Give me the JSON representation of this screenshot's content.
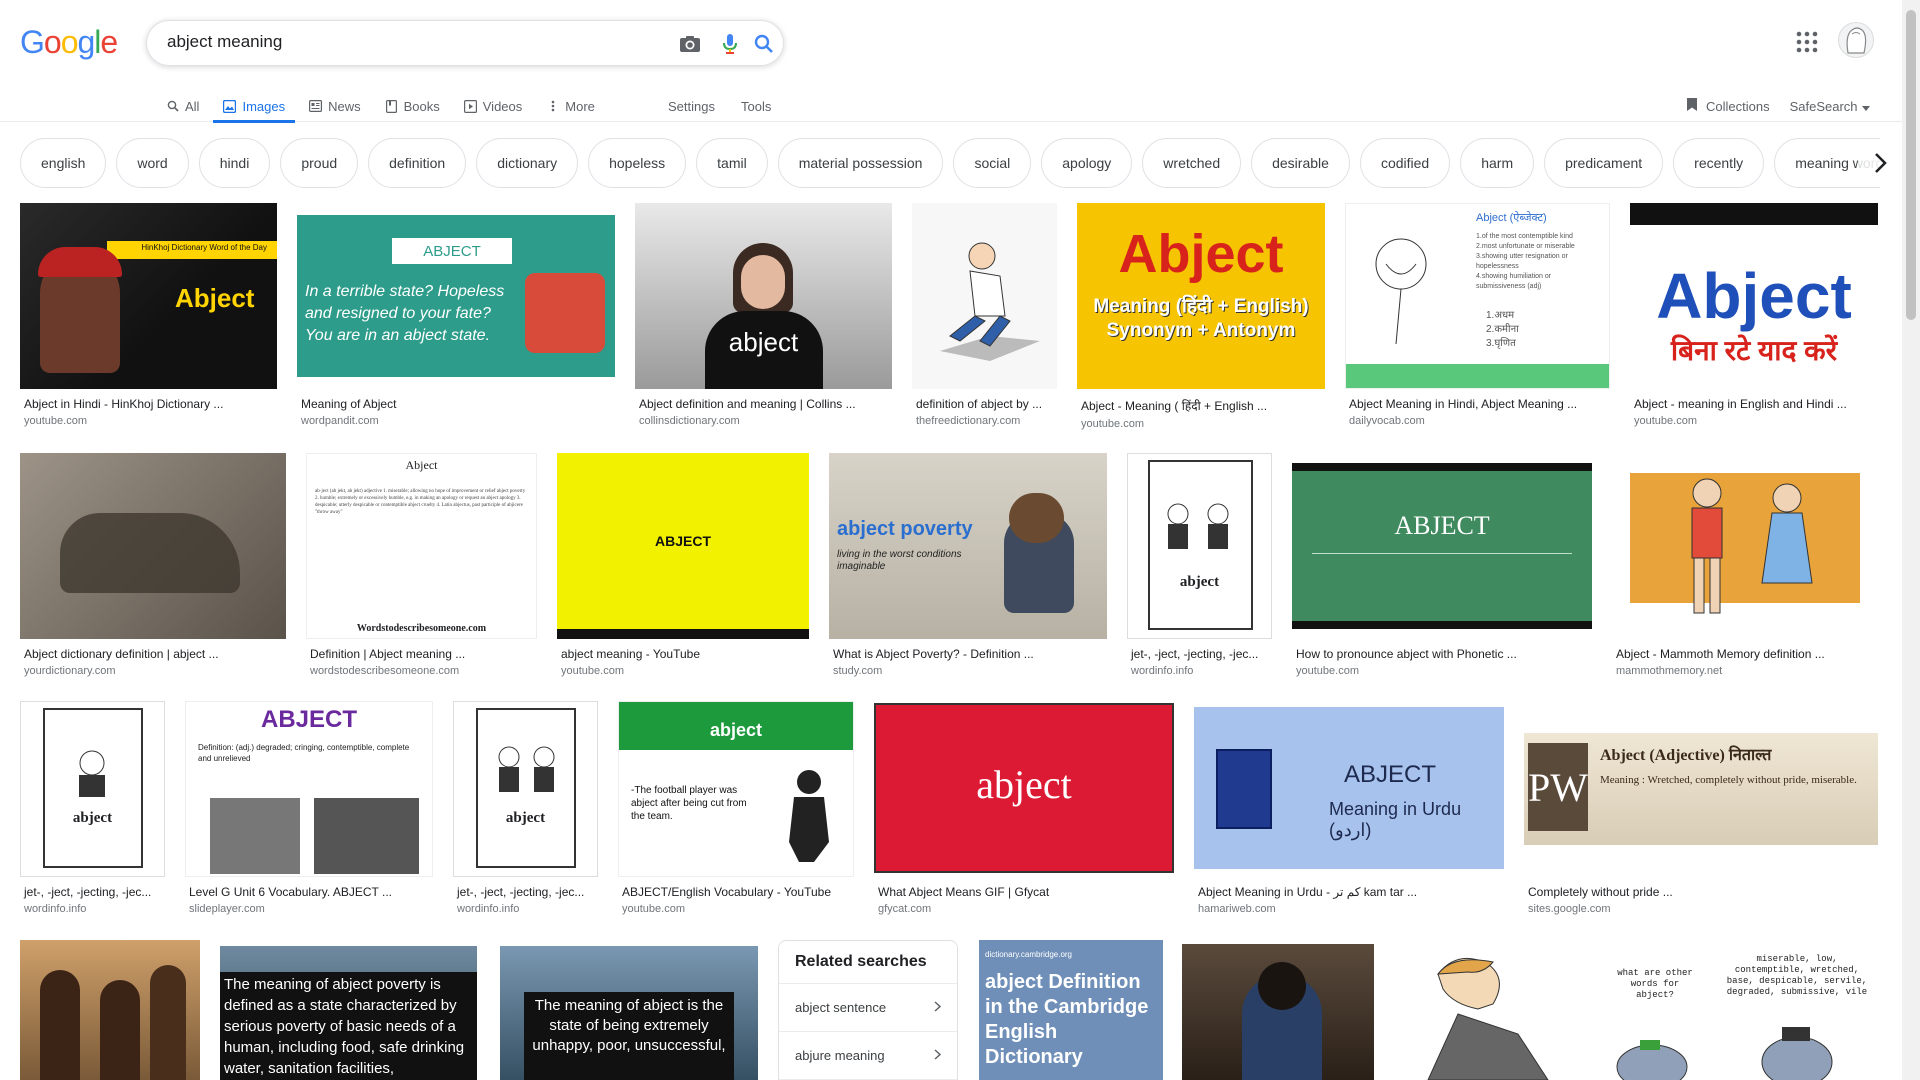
{
  "logo": {
    "letters": [
      "G",
      "o",
      "o",
      "g",
      "l",
      "e"
    ],
    "colors": [
      "#4285f4",
      "#ea4335",
      "#fbbc05",
      "#4285f4",
      "#34a853",
      "#ea4335"
    ]
  },
  "search": {
    "value": "abject meaning"
  },
  "tabs": [
    {
      "label": "All",
      "icon": "search-icon"
    },
    {
      "label": "Images",
      "icon": "image-icon"
    },
    {
      "label": "News",
      "icon": "news-icon"
    },
    {
      "label": "Books",
      "icon": "book-icon"
    },
    {
      "label": "Videos",
      "icon": "video-icon"
    },
    {
      "label": "More",
      "icon": "more-icon"
    }
  ],
  "tools": {
    "settings": "Settings",
    "tools": "Tools"
  },
  "top_right": {
    "collections": "Collections",
    "safesearch": "SafeSearch"
  },
  "chips": [
    "english",
    "word",
    "hindi",
    "proud",
    "definition",
    "dictionary",
    "hopeless",
    "tamil",
    "material possession",
    "social",
    "apology",
    "wretched",
    "desirable",
    "codified",
    "harm",
    "predicament",
    "recently",
    "meaning word m"
  ],
  "results": {
    "row1": [
      {
        "cap": "Abject in Hindi - HinKhoj Dictionary ...",
        "src": "youtube.com",
        "img_text": "Abject",
        "img_sub": "HinKhoj Dictionary Word of the Day"
      },
      {
        "cap": "Meaning of Abject",
        "src": "wordpandit.com",
        "img_text": "ABJECT",
        "img_sub": "In a terrible state? Hopeless and resigned to your fate? You are in an abject state."
      },
      {
        "cap": "Abject definition and meaning | Collins ...",
        "src": "collinsdictionary.com",
        "img_text": "abject"
      },
      {
        "cap": "definition of abject by ...",
        "src": "thefreedictionary.com"
      },
      {
        "cap": "Abject - Meaning ( हिंदी + English ...",
        "src": "youtube.com",
        "img_text": "Abject",
        "img_sub": "Meaning (हिंदी + English) Synonym + Antonym"
      },
      {
        "cap": "Abject Meaning in Hindi, Abject Meaning ...",
        "src": "dailyvocab.com",
        "img_text": "Abject (ऐब्जेक्ट)"
      },
      {
        "cap": "Abject - meaning in English and Hindi ...",
        "src": "youtube.com",
        "img_text": "Abject",
        "img_sub": "बिना रटे याद करें"
      }
    ],
    "row2": [
      {
        "cap": "Abject dictionary definition | abject ...",
        "src": "yourdictionary.com"
      },
      {
        "cap": "Definition | Abject meaning ...",
        "src": "wordstodescribesomeone.com",
        "img_text": "Abject",
        "img_sub": "Wordstodescribesomeone.com"
      },
      {
        "cap": "abject meaning - YouTube",
        "src": "youtube.com",
        "img_text": "ABJECT"
      },
      {
        "cap": "What is Abject Poverty? - Definition ...",
        "src": "study.com",
        "img_text": "abject poverty",
        "img_sub": "living in the worst conditions imaginable"
      },
      {
        "cap": "jet-, -ject, -jecting, -jec...",
        "src": "wordinfo.info",
        "img_text": "abject"
      },
      {
        "cap": "How to pronounce abject with Phonetic ...",
        "src": "youtube.com",
        "img_text": "ABJECT"
      },
      {
        "cap": "Abject - Mammoth Memory definition ...",
        "src": "mammothmemory.net"
      }
    ],
    "row3": [
      {
        "cap": "jet-, -ject, -jecting, -jec...",
        "src": "wordinfo.info",
        "img_text": "abject"
      },
      {
        "cap": "Level G Unit 6 Vocabulary. ABJECT ...",
        "src": "slideplayer.com",
        "img_text": "ABJECT",
        "img_sub": "Definition: (adj.) degraded; cringing, contemptible, complete and unrelieved"
      },
      {
        "cap": "jet-, -ject, -jecting, -jec...",
        "src": "wordinfo.info",
        "img_text": "abject"
      },
      {
        "cap": "ABJECT/English Vocabulary - YouTube",
        "src": "youtube.com",
        "img_text": "abject",
        "img_sub": "-The football player was abject after being cut from the team."
      },
      {
        "cap": "What Abject Means GIF | Gfycat",
        "src": "gfycat.com",
        "img_text": "abject"
      },
      {
        "cap": "Abject Meaning in Urdu - کم تر kam tar ...",
        "src": "hamariweb.com",
        "img_text": "ABJECT",
        "img_sub": "Meaning in Urdu (اردو)"
      },
      {
        "cap": "Completely without pride ...",
        "src": "sites.google.com",
        "img_text": "Abject (Adjective) निताल्त",
        "img_sub": "Meaning : Wretched, completely without pride, miserable."
      }
    ],
    "row4": [
      {
        "img_text": ""
      },
      {
        "img_text": "The meaning of abject poverty is defined as a state characterized by serious poverty of basic needs of a human, including food, safe drinking water, sanitation facilities,"
      },
      {
        "img_text": "The meaning of abject is the state of being extremely unhappy, poor, unsuccessful,"
      },
      {
        "img_text": "abject Definition in the Cambridge English Dictionary",
        "img_sub": "dictionary.cambridge.org"
      },
      {
        "img_text": ""
      },
      {
        "img_text": ""
      },
      {
        "img_text": "miserable, low, contemptible, wretched, base, despicable, servile, degraded, submissive, vile",
        "img_sub": "what are other words for abject?"
      }
    ]
  },
  "related": {
    "title": "Related searches",
    "items": [
      "abject sentence",
      "abjure meaning"
    ]
  }
}
